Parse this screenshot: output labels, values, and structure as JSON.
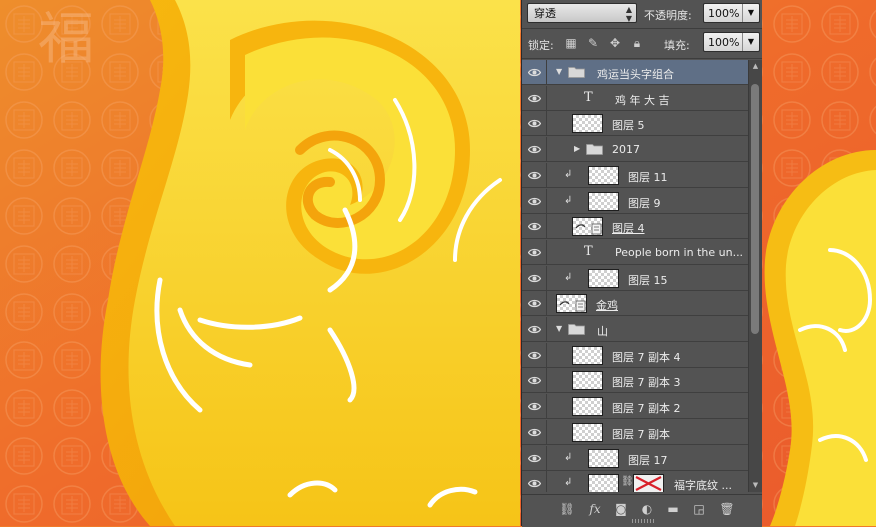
{
  "panel": {
    "blend_mode": "穿透",
    "opacity_label": "不透明度:",
    "opacity_value": "100%",
    "lock_label": "锁定:",
    "fill_label": "填充:",
    "fill_value": "100%"
  },
  "layers": [
    {
      "name": "鸡运当头字组合",
      "kind": "group",
      "expanded": true,
      "indent": 0,
      "selected": true
    },
    {
      "name": "鸡 年 大 吉",
      "kind": "text",
      "indent": 1
    },
    {
      "name": "图层 5",
      "kind": "raster",
      "indent": 1
    },
    {
      "name": "2017",
      "kind": "group",
      "expanded": false,
      "indent": 1
    },
    {
      "name": "图层 11",
      "kind": "raster",
      "indent": 1,
      "clipped": true
    },
    {
      "name": "图层 9",
      "kind": "raster",
      "indent": 1,
      "clipped": true
    },
    {
      "name": "图层 4",
      "kind": "smart",
      "indent": 1,
      "underline": true
    },
    {
      "name": "People born in the un...",
      "kind": "text",
      "indent": 1
    },
    {
      "name": "图层 15",
      "kind": "raster",
      "indent": 1,
      "clipped": true
    },
    {
      "name": "金鸡",
      "kind": "smart",
      "indent": 0,
      "underline": true
    },
    {
      "name": "山",
      "kind": "group",
      "expanded": true,
      "indent": 0
    },
    {
      "name": "图层 7 副本 4",
      "kind": "raster",
      "indent": 1
    },
    {
      "name": "图层 7 副本 3",
      "kind": "raster",
      "indent": 1
    },
    {
      "name": "图层 7 副本 2",
      "kind": "raster",
      "indent": 1
    },
    {
      "name": "图层 7 副本",
      "kind": "raster",
      "indent": 1
    },
    {
      "name": "图层 17",
      "kind": "raster",
      "indent": 1,
      "clipped": true
    },
    {
      "name": "福字底纹 ...",
      "kind": "masked",
      "indent": 1,
      "clipped": true
    }
  ],
  "bottom_icons": [
    "link-icon",
    "fx-icon",
    "mask-icon",
    "adjustment-icon",
    "folder-icon",
    "new-layer-icon",
    "trash-icon"
  ],
  "colors": {
    "panel_bg": "#535353",
    "selected_row": "#5f6f86",
    "background_orange": "#f07a2a",
    "swirl_yellow": "#f8d21a"
  },
  "canvas": {
    "background_char": "福"
  }
}
